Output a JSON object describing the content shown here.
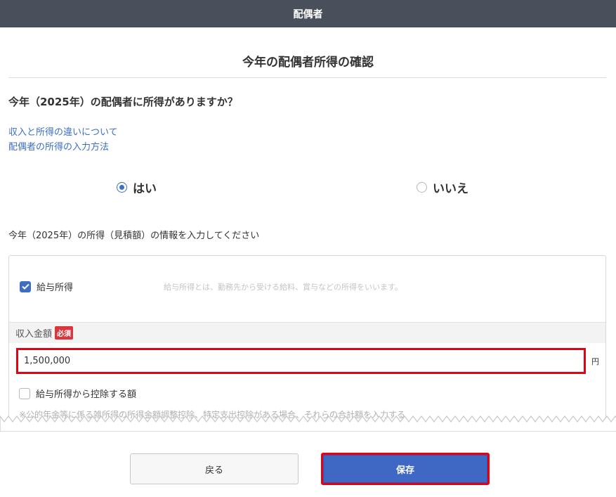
{
  "header": {
    "title": "配偶者"
  },
  "page": {
    "title": "今年の配偶者所得の確認"
  },
  "question": "今年（2025年）の配偶者に所得がありますか？",
  "links": [
    {
      "label": "収入と所得の違いについて"
    },
    {
      "label": "配偶者の所得の入力方法"
    }
  ],
  "answer": {
    "yes_label": "はい",
    "no_label": "いいえ",
    "selected": "yes"
  },
  "instruction": "今年（2025年）の所得（見積額）の情報を入力してください",
  "salary": {
    "label": "給与所得",
    "checked": true,
    "description": "給与所得とは、勤務先から受ける給料、賞与などの所得をいいます。"
  },
  "income": {
    "label": "収入金額",
    "required_badge": "必須",
    "value": "1,500,000",
    "unit": "円"
  },
  "deduction": {
    "label": "給与所得から控除する額",
    "checked": false,
    "note": "※公的年金等に係る雑所得の所得金額調整控除、特定支出控除がある場合、それらの合計額を入力する"
  },
  "buttons": {
    "back": "戻る",
    "save": "保存"
  },
  "colors": {
    "accent": "#3c6fc3",
    "header_bg": "#4a4f5c",
    "highlight": "#e60012",
    "badge": "#d9363e"
  }
}
